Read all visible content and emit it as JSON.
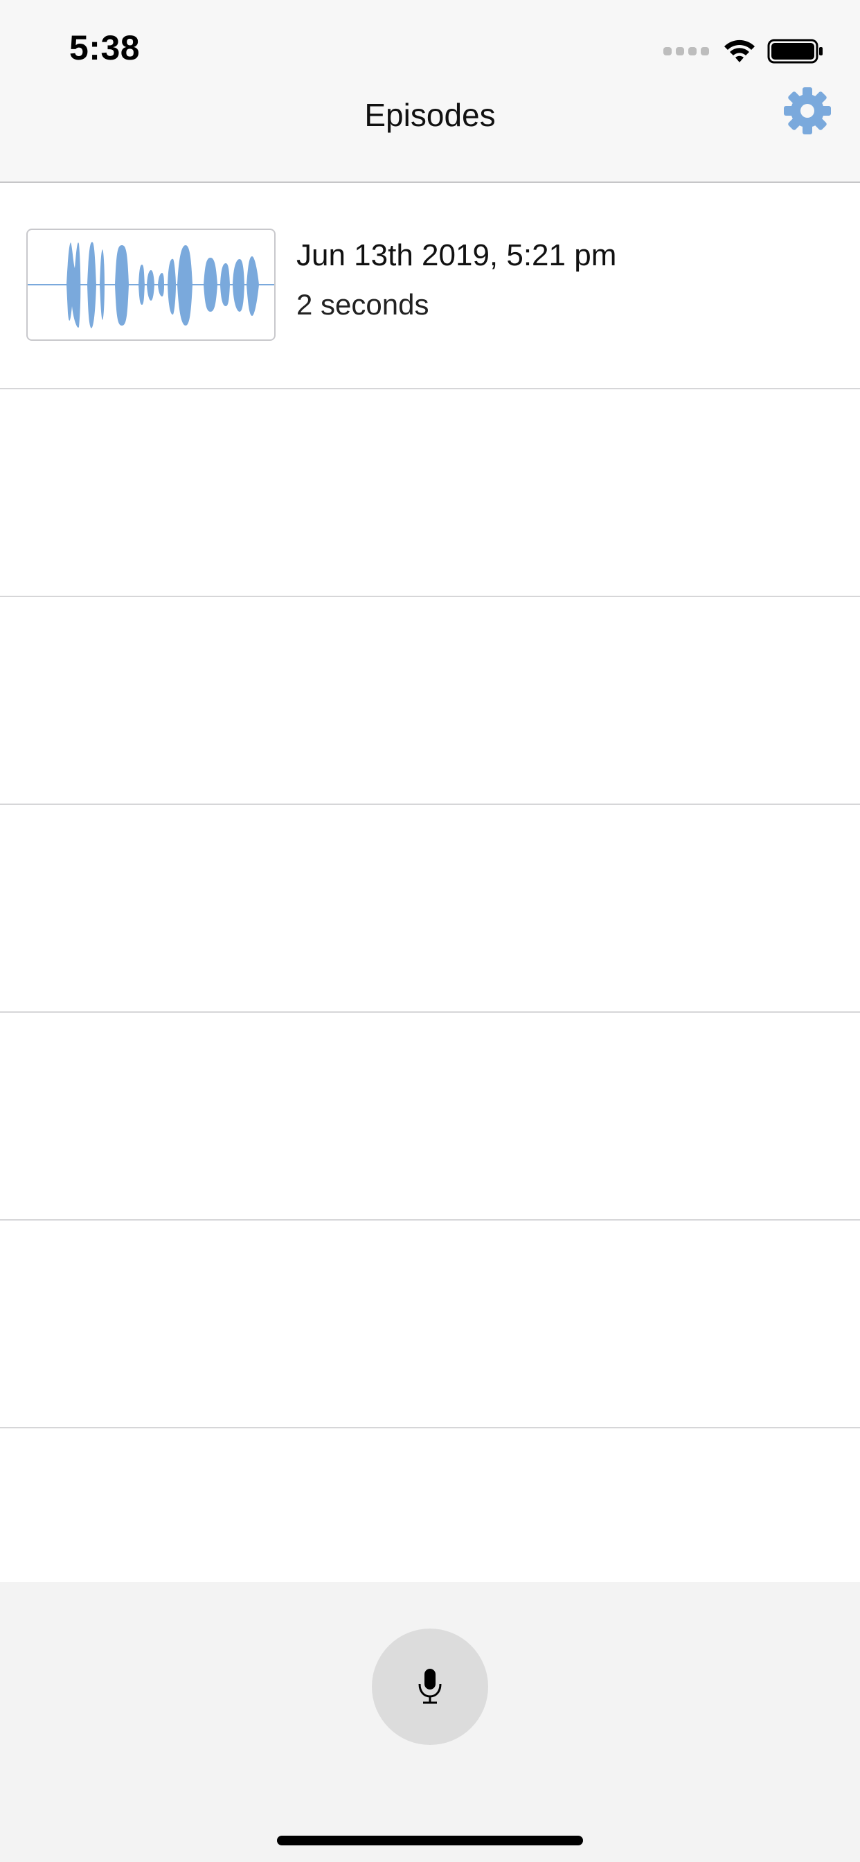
{
  "status_bar": {
    "time": "5:38",
    "signal_icon": "signal-dots-icon",
    "wifi_icon": "wifi-icon",
    "battery_icon": "battery-icon"
  },
  "nav": {
    "title": "Episodes",
    "settings_icon": "gear-icon"
  },
  "episodes": [
    {
      "title": "Jun 13th 2019, 5:21 pm",
      "subtitle": "2 seconds",
      "thumbnail_icon": "waveform-icon"
    }
  ],
  "bottom_bar": {
    "record_icon": "microphone-icon"
  },
  "colors": {
    "accent": "#7aa9dc",
    "background": "#ffffff",
    "bar_background": "#f3f3f3",
    "button_background": "#dcdcdc"
  }
}
